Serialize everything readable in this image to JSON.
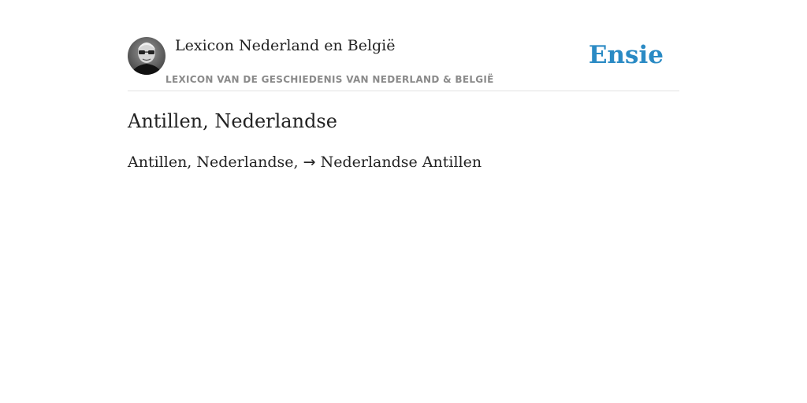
{
  "header": {
    "site_title": "Lexicon Nederland en België",
    "subtitle": "LEXICON VAN DE GESCHIEDENIS VAN NEDERLAND & BELGIË",
    "brand": "Ensie",
    "avatar_icon": "author-portrait"
  },
  "article": {
    "title": "Antillen, Nederlandse",
    "entry_term": "Antillen, Nederlandse,",
    "arrow": "→",
    "link_text": "Nederlandse Antillen"
  },
  "colors": {
    "brand": "#2a8ac4",
    "text": "#222222",
    "subtitle": "#8a8a8a",
    "divider": "#e2e2e2"
  }
}
